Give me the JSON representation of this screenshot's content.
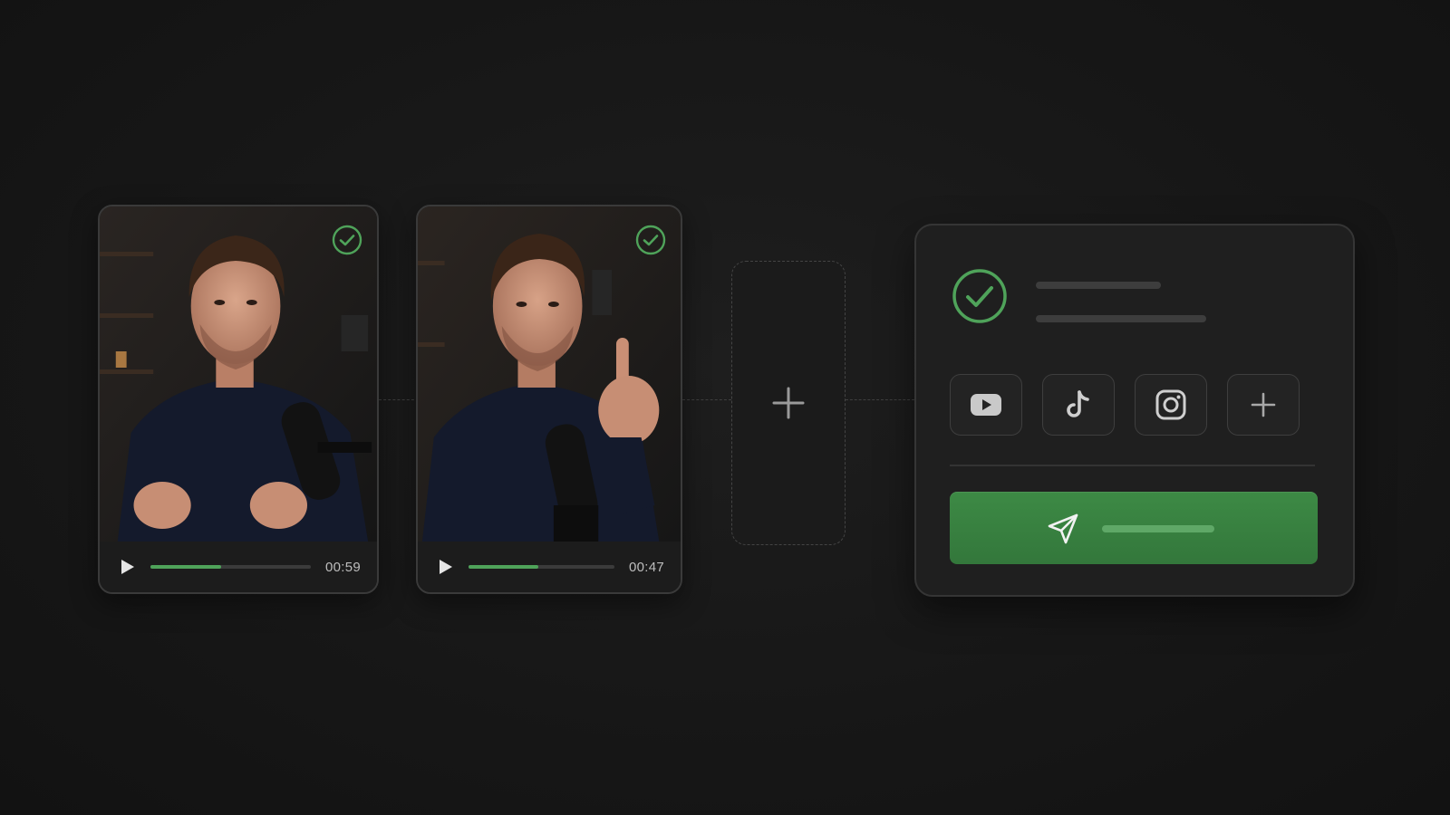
{
  "videos": [
    {
      "duration": "00:59",
      "progress": 0.44,
      "status_icon": "check-circle-icon",
      "status_color": "#4fa35a"
    },
    {
      "duration": "00:47",
      "progress": 0.48,
      "status_icon": "check-circle-icon",
      "status_color": "#4fa35a"
    }
  ],
  "empty_slot": {
    "icon": "plus-icon"
  },
  "publish_panel": {
    "status_icon": "check-circle-icon",
    "platforms": [
      {
        "icon": "youtube-icon"
      },
      {
        "icon": "tiktok-icon"
      },
      {
        "icon": "instagram-icon"
      },
      {
        "icon": "plus-icon"
      }
    ],
    "publish_icon": "send-icon",
    "accent_color": "#3d8a45"
  }
}
